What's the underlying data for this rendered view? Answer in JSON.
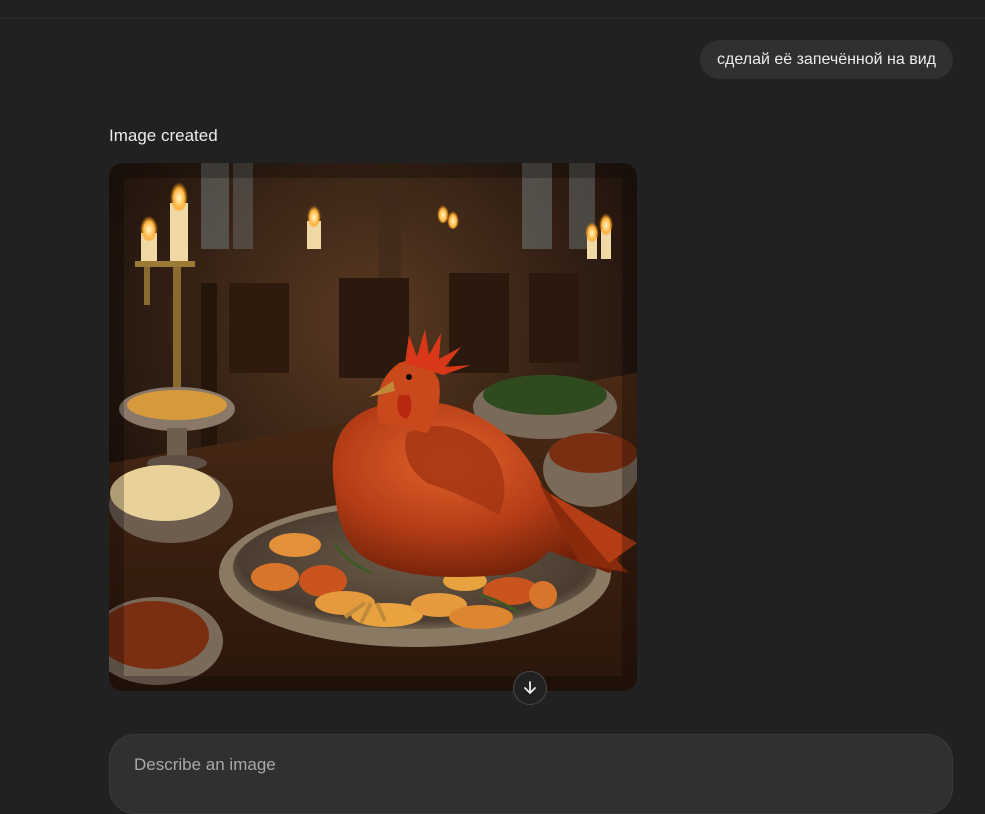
{
  "conversation": {
    "user_message": "сделай её запечённой на вид",
    "status_label": "Image created",
    "image_icon": "generated-image"
  },
  "scroll_button": {
    "icon": "arrow-down-icon"
  },
  "composer": {
    "placeholder": "Describe an image",
    "value": ""
  },
  "colors": {
    "background": "#212121",
    "bubble": "#303030",
    "text": "#ececec",
    "placeholder": "#a8a8a8"
  }
}
